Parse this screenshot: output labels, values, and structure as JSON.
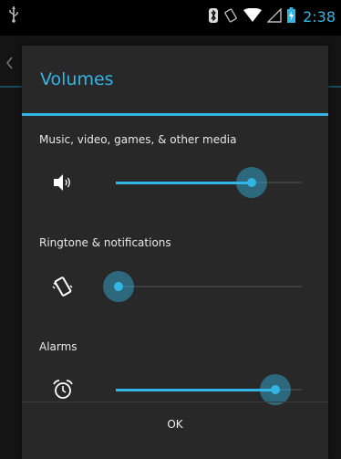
{
  "status_bar": {
    "time": "2:38",
    "icons": [
      "usb-icon",
      "bluetooth-icon",
      "vibrate-icon",
      "wifi-icon",
      "signal-icon",
      "battery-charging-icon"
    ]
  },
  "dialog": {
    "title": "Volumes",
    "sections": [
      {
        "label": "Music, video, games, & other media",
        "icon": "speaker-icon",
        "level": 0.73
      },
      {
        "label": "Ringtone & notifications",
        "icon": "vibrate-phone-icon",
        "level": 0.0
      },
      {
        "label": "Alarms",
        "icon": "alarm-clock-icon",
        "level": 0.86
      }
    ],
    "ok_label": "OK"
  },
  "colors": {
    "accent": "#33b5e5",
    "dialog_bg": "#282828",
    "status_bar_bg": "#000000"
  }
}
